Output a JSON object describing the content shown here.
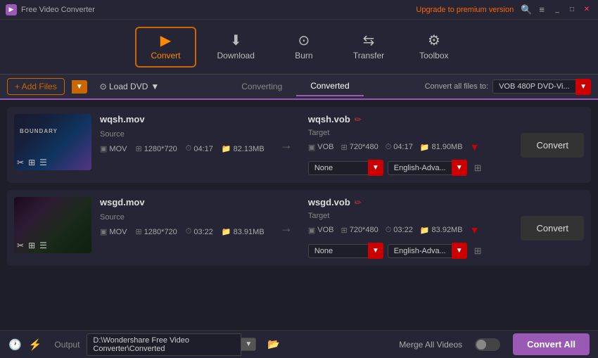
{
  "titleBar": {
    "appName": "Free Video Converter",
    "upgradeText": "Upgrade to premium version",
    "searchIcon": "🔍",
    "menuIcon": "≡",
    "minimizeIcon": "_",
    "maximizeIcon": "□",
    "closeIcon": "✕"
  },
  "nav": {
    "items": [
      {
        "id": "convert",
        "label": "Convert",
        "icon": "▶",
        "active": true
      },
      {
        "id": "download",
        "label": "Download",
        "icon": "⬇",
        "active": false
      },
      {
        "id": "burn",
        "label": "Burn",
        "icon": "⊙",
        "active": false
      },
      {
        "id": "transfer",
        "label": "Transfer",
        "icon": "⇆",
        "active": false
      },
      {
        "id": "toolbox",
        "label": "Toolbox",
        "icon": "⚙",
        "active": false
      }
    ]
  },
  "toolbar": {
    "addFilesLabel": "+ Add Files",
    "loadDvdLabel": "⊙ Load DVD",
    "tabs": [
      {
        "id": "converting",
        "label": "Converting",
        "active": false
      },
      {
        "id": "converted",
        "label": "Converted",
        "active": true
      }
    ],
    "convertAllLabel": "Convert all files to:",
    "formatValue": "VOB 480P DVD-Vi..."
  },
  "files": [
    {
      "id": "file1",
      "sourceName": "wqsh.mov",
      "targetName": "wqsh.vob",
      "sourceLabel": "Source",
      "targetLabel": "Target",
      "sourceMeta": {
        "format": "MOV",
        "resolution": "1280*720",
        "duration": "04:17",
        "size": "82.13MB"
      },
      "targetMeta": {
        "format": "VOB",
        "resolution": "720*480",
        "duration": "04:17",
        "size": "81.90MB"
      },
      "subtitleOption": "None",
      "audioOption": "English-Adva...",
      "convertLabel": "Convert"
    },
    {
      "id": "file2",
      "sourceName": "wsgd.mov",
      "targetName": "wsgd.vob",
      "sourceLabel": "Source",
      "targetLabel": "Target",
      "sourceMeta": {
        "format": "MOV",
        "resolution": "1280*720",
        "duration": "03:22",
        "size": "83.91MB"
      },
      "targetMeta": {
        "format": "VOB",
        "resolution": "720*480",
        "duration": "03:22",
        "size": "83.92MB"
      },
      "subtitleOption": "None",
      "audioOption": "English-Adva...",
      "convertLabel": "Convert"
    }
  ],
  "bottomBar": {
    "outputLabel": "Output",
    "outputPath": "D:\\Wondershare Free Video Converter\\Converted",
    "mergeLabel": "Merge All Videos",
    "convertAllLabel": "Convert All"
  }
}
